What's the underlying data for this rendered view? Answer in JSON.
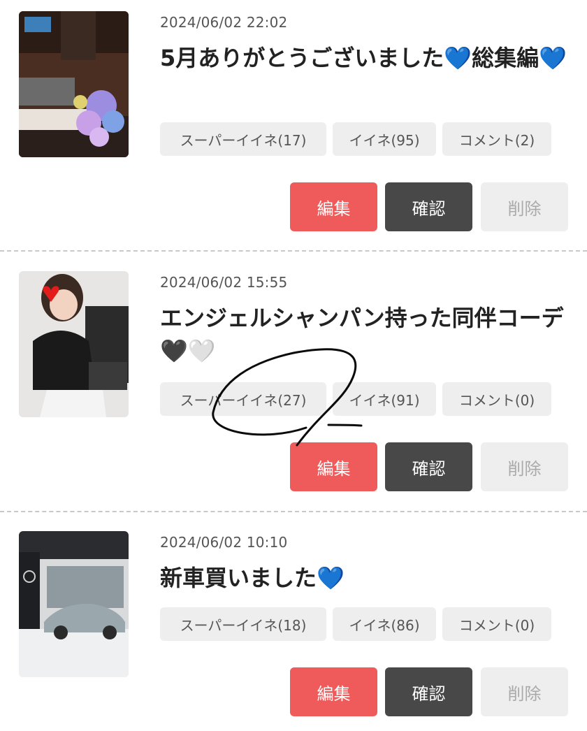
{
  "posts": [
    {
      "datetime": "2024/06/02 22:02",
      "title": "5月ありがとうございました💙総集編💙",
      "super_like": "スーパーイイネ(17)",
      "like": "イイネ(95)",
      "comment": "コメント(2)",
      "edit": "編集",
      "check": "確認",
      "delete": "削除"
    },
    {
      "datetime": "2024/06/02 15:55",
      "title": "エンジェルシャンパン持った同伴コーデ🖤🤍",
      "super_like": "スーパーイイネ(27)",
      "like": "イイネ(91)",
      "comment": "コメント(0)",
      "edit": "編集",
      "check": "確認",
      "delete": "削除"
    },
    {
      "datetime": "2024/06/02 10:10",
      "title": "新車買いました💙",
      "super_like": "スーパーイイネ(18)",
      "like": "イイネ(86)",
      "comment": "コメント(0)",
      "edit": "編集",
      "check": "確認",
      "delete": "削除"
    }
  ],
  "colors": {
    "edit_button": "#ef5a5a",
    "check_button": "#484848",
    "delete_button": "#eeeeee",
    "pill_background": "#eeeeee"
  }
}
